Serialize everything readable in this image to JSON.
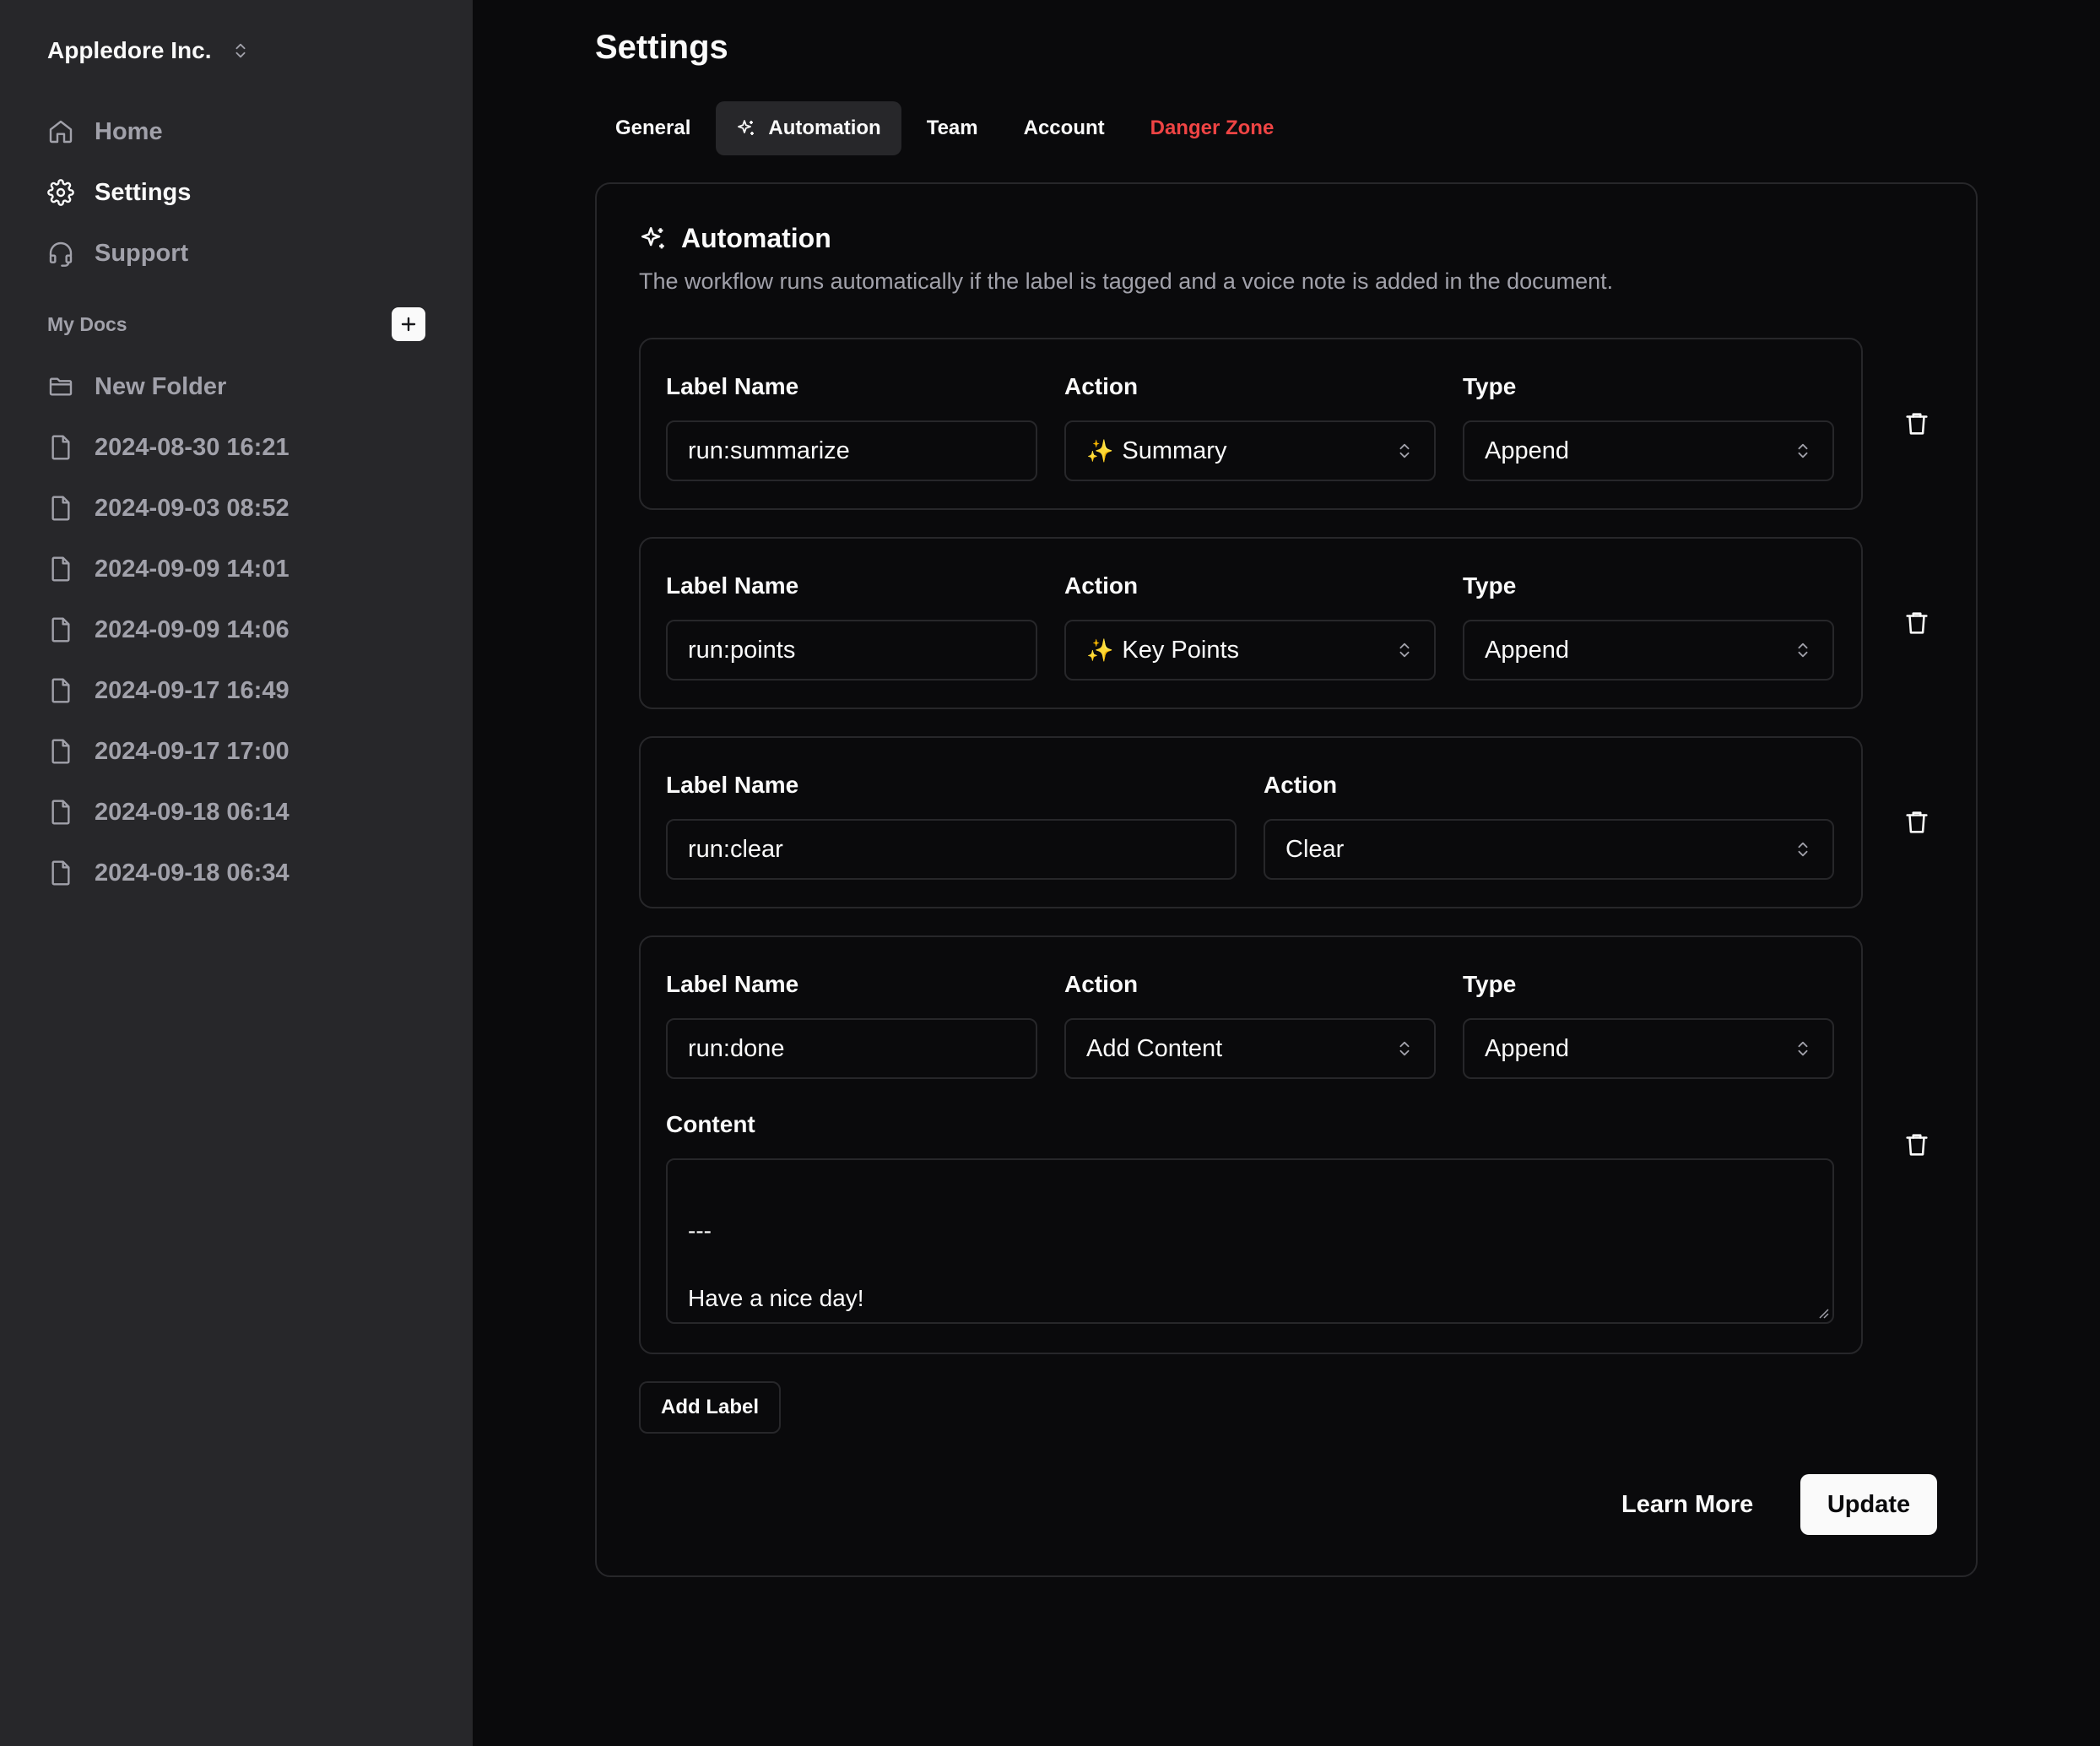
{
  "sidebar": {
    "org_name": "Appledore Inc.",
    "nav": [
      {
        "label": "Home",
        "icon": "home-icon"
      },
      {
        "label": "Settings",
        "icon": "gear-icon"
      },
      {
        "label": "Support",
        "icon": "headset-icon"
      }
    ],
    "section_label": "My Docs",
    "folder": {
      "label": "New Folder",
      "icon": "folder-icon"
    },
    "docs": [
      "2024-08-30 16:21",
      "2024-09-03 08:52",
      "2024-09-09 14:01",
      "2024-09-09 14:06",
      "2024-09-17 16:49",
      "2024-09-17 17:00",
      "2024-09-18 06:14",
      "2024-09-18 06:34"
    ]
  },
  "page": {
    "title": "Settings",
    "tabs": [
      {
        "label": "General"
      },
      {
        "label": "Automation",
        "active": true
      },
      {
        "label": "Team"
      },
      {
        "label": "Account"
      },
      {
        "label": "Danger Zone",
        "danger": true
      }
    ]
  },
  "card": {
    "title": "Automation",
    "description": "The workflow runs automatically if the label is tagged and a voice note is added in the document.",
    "field_labels": {
      "label_name": "Label Name",
      "action": "Action",
      "type": "Type",
      "content": "Content"
    },
    "rules": [
      {
        "label_name": "run:summarize",
        "action": "Summary",
        "action_sparkle": "✨",
        "type": "Append"
      },
      {
        "label_name": "run:points",
        "action": "Key Points",
        "action_sparkle": "✨",
        "type": "Append"
      },
      {
        "label_name": "run:clear",
        "action": "Clear"
      },
      {
        "label_name": "run:done",
        "action": "Add Content",
        "type": "Append",
        "content_lines": [
          "",
          "---",
          "",
          "Have a nice day!"
        ]
      }
    ],
    "add_label": "Add Label",
    "learn_more": "Learn More",
    "update": "Update"
  },
  "colors": {
    "sidebar_bg": "#27272a",
    "main_bg": "#0a0a0c",
    "border": "#27272a",
    "danger": "#ef4444",
    "muted_text": "#a1a1aa",
    "primary_button_bg": "#fafafa"
  }
}
